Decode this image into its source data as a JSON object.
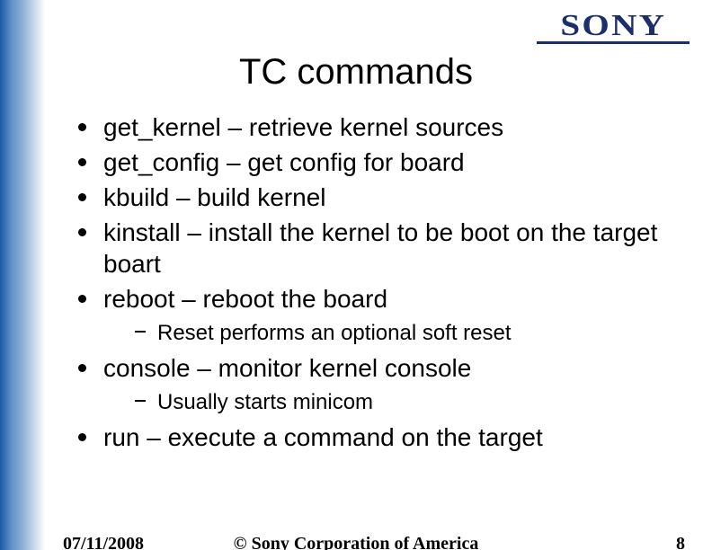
{
  "logo": "SONY",
  "title": "TC commands",
  "bullets": {
    "b1": "get_kernel – retrieve kernel sources",
    "b2": "get_config – get config for board",
    "b3": "kbuild – build kernel",
    "b4": "kinstall – install the kernel to be boot on the target boart",
    "b5": "reboot – reboot the board",
    "b5s1": "Reset performs an optional soft reset",
    "b6": "console – monitor kernel console",
    "b6s1": "Usually starts minicom",
    "b7": "run – execute a command on the target"
  },
  "footer": {
    "date": "07/11/2008",
    "copyright": "© Sony Corporation of America",
    "page": "8"
  }
}
